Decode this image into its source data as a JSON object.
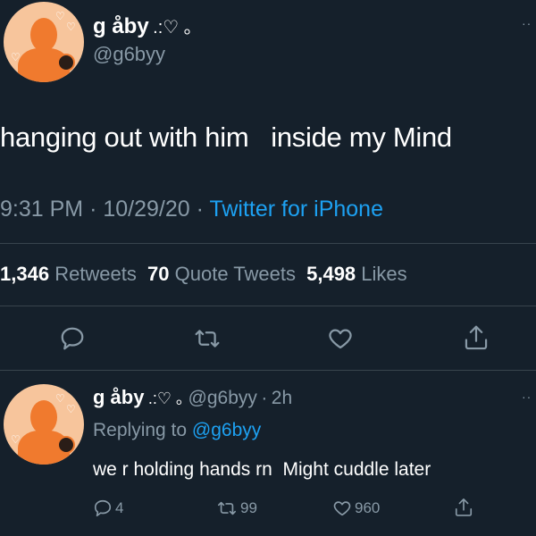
{
  "main_tweet": {
    "display_name": "g åby",
    "name_decor": ".:♡ ｡",
    "handle": "@g6byy",
    "text": "hanging out with him   inside my Mind",
    "time": "9:31 PM",
    "date": "10/29/20",
    "separator": "·",
    "source": "Twitter for iPhone",
    "stats": {
      "retweets_count": "1,346",
      "retweets_label": "Retweets",
      "quotes_count": "70",
      "quotes_label": "Quote Tweets",
      "likes_count": "5,498",
      "likes_label": "Likes"
    },
    "actions": [
      "reply-icon",
      "retweet-icon",
      "like-icon",
      "share-icon"
    ]
  },
  "reply_tweet": {
    "display_name": "g åby",
    "name_decor": ".:♡ ｡",
    "handle": "@g6byy",
    "separator": "·",
    "age": "2h",
    "replying_prefix": "Replying to",
    "replying_to": "@g6byy",
    "text": "we r holding hands rn  Might cuddle later",
    "reply_count": "4",
    "retweet_count": "99",
    "like_count": "960"
  },
  "more_menu": "··",
  "colors": {
    "background": "#15202b",
    "accent": "#1da1f2",
    "secondary_text": "#8899a6",
    "divider": "#38444d",
    "avatar_bg": "#f7c59c",
    "avatar_figure": "#f07a2e"
  }
}
